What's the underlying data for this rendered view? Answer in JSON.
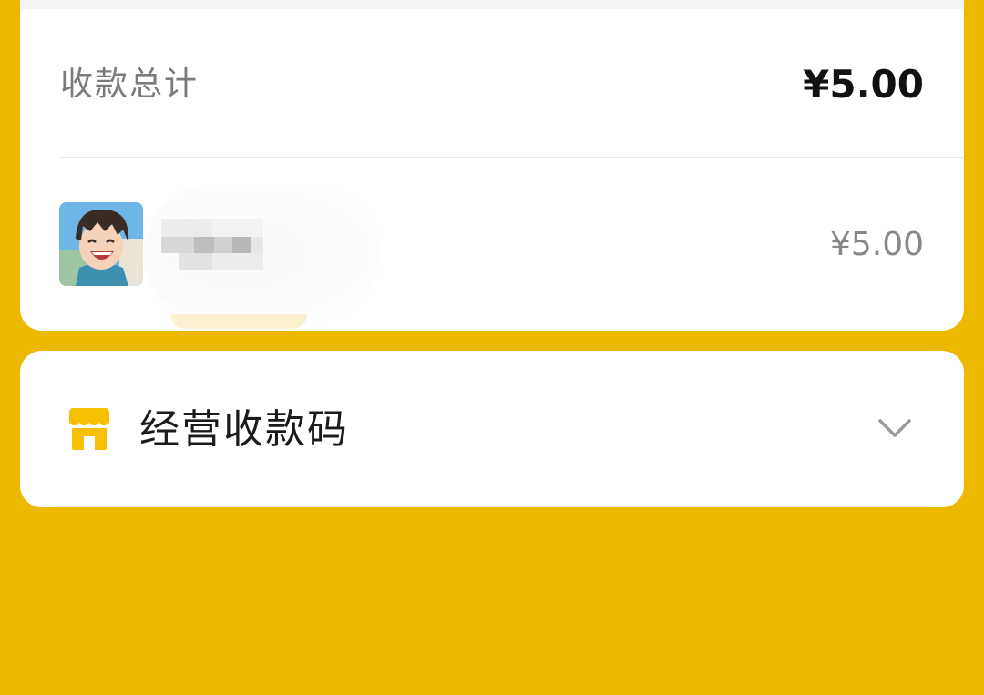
{
  "summary": {
    "total_label": "收款总计",
    "total_amount": "¥5.00"
  },
  "payments": [
    {
      "payer_name": "",
      "amount": "¥5.00"
    }
  ],
  "merchant_code": {
    "title": "经营收款码",
    "icon": "shop-icon",
    "expand_icon": "chevron-down-icon"
  },
  "colors": {
    "background": "#EDB800",
    "accent": "#F7C000",
    "card": "#FFFFFF"
  }
}
